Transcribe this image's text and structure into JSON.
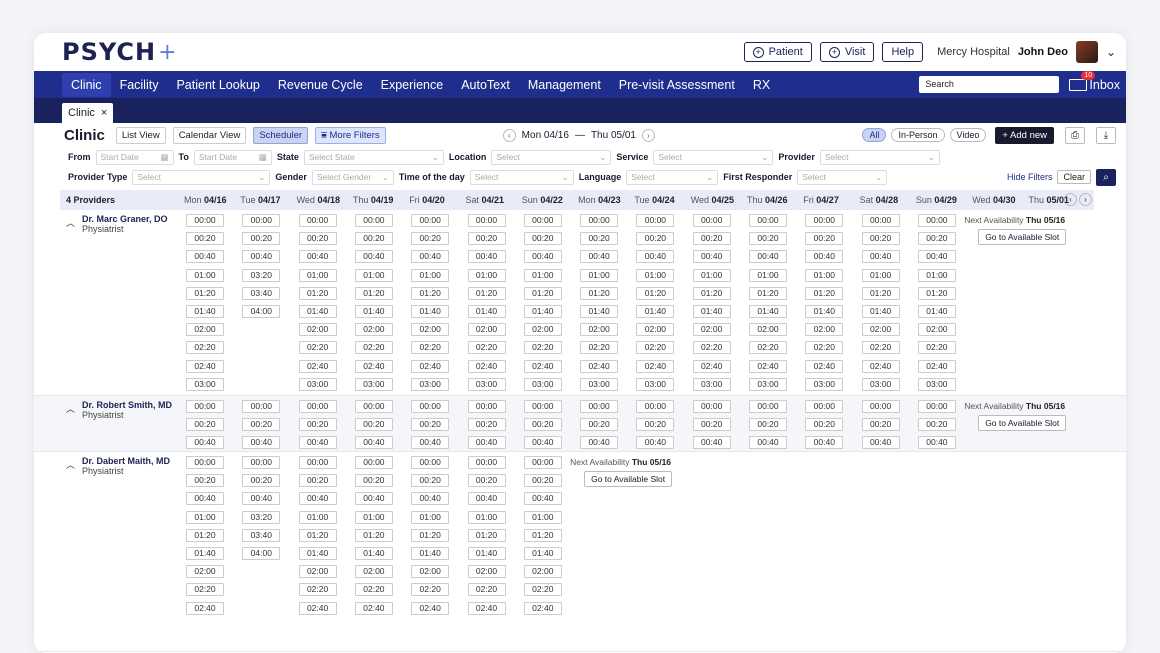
{
  "brand": {
    "logo": "PSYCH",
    "logo_mark": "+"
  },
  "topbar": {
    "patient_label": "Patient",
    "visit_label": "Visit",
    "help_label": "Help",
    "hospital": "Mercy Hospital",
    "user": "John Deo"
  },
  "nav": {
    "items": [
      "Clinic",
      "Facility",
      "Patient Lookup",
      "Revenue Cycle",
      "Experience",
      "AutoText",
      "Management",
      "Pre-visit Assessment",
      "RX"
    ],
    "search_placeholder": "Search",
    "inbox_label": "Inbox",
    "inbox_count": "10"
  },
  "tab": {
    "label": "Clinic",
    "close": "×"
  },
  "toolbar": {
    "title": "Clinic",
    "list_view": "List View",
    "calendar_view": "Calendar View",
    "scheduler": "Scheduler",
    "more_filters": "More Filters",
    "range_start": "Mon 04/16",
    "range_sep": "—",
    "range_end": "Thu 05/01",
    "pill_all": "All",
    "pill_inperson": "In-Person",
    "pill_video": "Video",
    "add_new": "+ Add new"
  },
  "filters": {
    "from_label": "From",
    "from_ph": "Start Date",
    "to_label": "To",
    "to_ph": "Start Date",
    "state_label": "State",
    "state_ph": "Select State",
    "location_label": "Location",
    "location_ph": "Select",
    "service_label": "Service",
    "service_ph": "Select",
    "provider_label": "Provider",
    "provider_ph": "Select",
    "ptype_label": "Provider Type",
    "ptype_ph": "Select",
    "gender_label": "Gender",
    "gender_ph": "Select Gender",
    "tod_label": "Time of the day",
    "tod_ph": "Select",
    "lang_label": "Language",
    "lang_ph": "Select",
    "fr_label": "First Responder",
    "fr_ph": "Select",
    "hide_filters": "Hide Filters",
    "clear": "Clear"
  },
  "grid": {
    "providers_count": "4 Providers",
    "days": [
      {
        "dow": "Mon",
        "date": "04/16"
      },
      {
        "dow": "Tue",
        "date": "04/17"
      },
      {
        "dow": "Wed",
        "date": "04/18"
      },
      {
        "dow": "Thu",
        "date": "04/19"
      },
      {
        "dow": "Fri",
        "date": "04/20"
      },
      {
        "dow": "Sat",
        "date": "04/21"
      },
      {
        "dow": "Sun",
        "date": "04/22"
      },
      {
        "dow": "Mon",
        "date": "04/23"
      },
      {
        "dow": "Tue",
        "date": "04/24"
      },
      {
        "dow": "Wed",
        "date": "04/25"
      },
      {
        "dow": "Thu",
        "date": "04/26"
      },
      {
        "dow": "Fri",
        "date": "04/27"
      },
      {
        "dow": "Sat",
        "date": "04/28"
      },
      {
        "dow": "Sun",
        "date": "04/29"
      },
      {
        "dow": "Wed",
        "date": "04/30"
      },
      {
        "dow": "Thu",
        "date": "05/01"
      }
    ],
    "next_label": "Next Availability",
    "go_label": "Go to Available Slot",
    "providers": [
      {
        "name": "Dr. Marc Graner, DO",
        "role": "Physiatrist",
        "next_date": "Thu 05/16",
        "slots": [
          [
            "00:00",
            "00:20",
            "00:40",
            "01:00",
            "01:20",
            "01:40",
            "02:00",
            "02:20",
            "02:40",
            "03:00"
          ],
          [
            "00:00",
            "00:20",
            "00:40",
            "03:20",
            "03:40",
            "04:00"
          ],
          [
            "00:00",
            "00:20",
            "00:40",
            "01:00",
            "01:20",
            "01:40",
            "02:00",
            "02:20",
            "02:40",
            "03:00"
          ],
          [
            "00:00",
            "00:20",
            "00:40",
            "01:00",
            "01:20",
            "01:40",
            "02:00",
            "02:20",
            "02:40",
            "03:00"
          ],
          [
            "00:00",
            "00:20",
            "00:40",
            "01:00",
            "01:20",
            "01:40",
            "02:00",
            "02:20",
            "02:40",
            "03:00"
          ],
          [
            "00:00",
            "00:20",
            "00:40",
            "01:00",
            "01:20",
            "01:40",
            "02:00",
            "02:20",
            "02:40",
            "03:00"
          ],
          [
            "00:00",
            "00:20",
            "00:40",
            "01:00",
            "01:20",
            "01:40",
            "02:00",
            "02:20",
            "02:40",
            "03:00"
          ],
          [
            "00:00",
            "00:20",
            "00:40",
            "01:00",
            "01:20",
            "01:40",
            "02:00",
            "02:20",
            "02:40",
            "03:00"
          ],
          [
            "00:00",
            "00:20",
            "00:40",
            "01:00",
            "01:20",
            "01:40",
            "02:00",
            "02:20",
            "02:40",
            "03:00"
          ],
          [
            "00:00",
            "00:20",
            "00:40",
            "01:00",
            "01:20",
            "01:40",
            "02:00",
            "02:20",
            "02:40",
            "03:00"
          ],
          [
            "00:00",
            "00:20",
            "00:40",
            "01:00",
            "01:20",
            "01:40",
            "02:00",
            "02:20",
            "02:40",
            "03:00"
          ],
          [
            "00:00",
            "00:20",
            "00:40",
            "01:00",
            "01:20",
            "01:40",
            "02:00",
            "02:20",
            "02:40",
            "03:00"
          ],
          [
            "00:00",
            "00:20",
            "00:40",
            "01:00",
            "01:20",
            "01:40",
            "02:00",
            "02:20",
            "02:40",
            "03:00"
          ],
          [
            "00:00",
            "00:20",
            "00:40",
            "01:00",
            "01:20",
            "01:40",
            "02:00",
            "02:20",
            "02:40",
            "03:00"
          ]
        ]
      },
      {
        "name": "Dr. Robert Smith, MD",
        "role": "Physiatrist",
        "next_date": "Thu 05/16",
        "slots": [
          [
            "00:00",
            "00:20",
            "00:40"
          ],
          [
            "00:00",
            "00:20",
            "00:40"
          ],
          [
            "00:00",
            "00:20",
            "00:40"
          ],
          [
            "00:00",
            "00:20",
            "00:40"
          ],
          [
            "00:00",
            "00:20",
            "00:40"
          ],
          [
            "00:00",
            "00:20",
            "00:40"
          ],
          [
            "00:00",
            "00:20",
            "00:40"
          ],
          [
            "00:00",
            "00:20",
            "00:40"
          ],
          [
            "00:00",
            "00:20",
            "00:40"
          ],
          [
            "00:00",
            "00:20",
            "00:40"
          ],
          [
            "00:00",
            "00:20",
            "00:40"
          ],
          [
            "00:00",
            "00:20",
            "00:40"
          ],
          [
            "00:00",
            "00:20",
            "00:40"
          ],
          [
            "00:00",
            "00:20",
            "00:40"
          ]
        ]
      },
      {
        "name": "Dr. Dabert Maith, MD",
        "role": "Physiatrist",
        "next_date": "Thu 05/16",
        "slots": [
          [
            "00:00",
            "00:20",
            "00:40",
            "01:00",
            "01:20",
            "01:40",
            "02:00",
            "02:20",
            "02:40"
          ],
          [
            "00:00",
            "00:20",
            "00:40",
            "03:20",
            "03:40",
            "04:00"
          ],
          [
            "00:00",
            "00:20",
            "00:40",
            "01:00",
            "01:20",
            "01:40",
            "02:00",
            "02:20",
            "02:40"
          ],
          [
            "00:00",
            "00:20",
            "00:40",
            "01:00",
            "01:20",
            "01:40",
            "02:00",
            "02:20",
            "02:40"
          ],
          [
            "00:00",
            "00:20",
            "00:40",
            "01:00",
            "01:20",
            "01:40",
            "02:00",
            "02:20",
            "02:40"
          ],
          [
            "00:00",
            "00:20",
            "00:40",
            "01:00",
            "01:20",
            "01:40",
            "02:00",
            "02:20",
            "02:40"
          ],
          [
            "00:00",
            "00:20",
            "00:40",
            "01:00",
            "01:20",
            "01:40",
            "02:00",
            "02:20",
            "02:40"
          ]
        ]
      }
    ]
  }
}
